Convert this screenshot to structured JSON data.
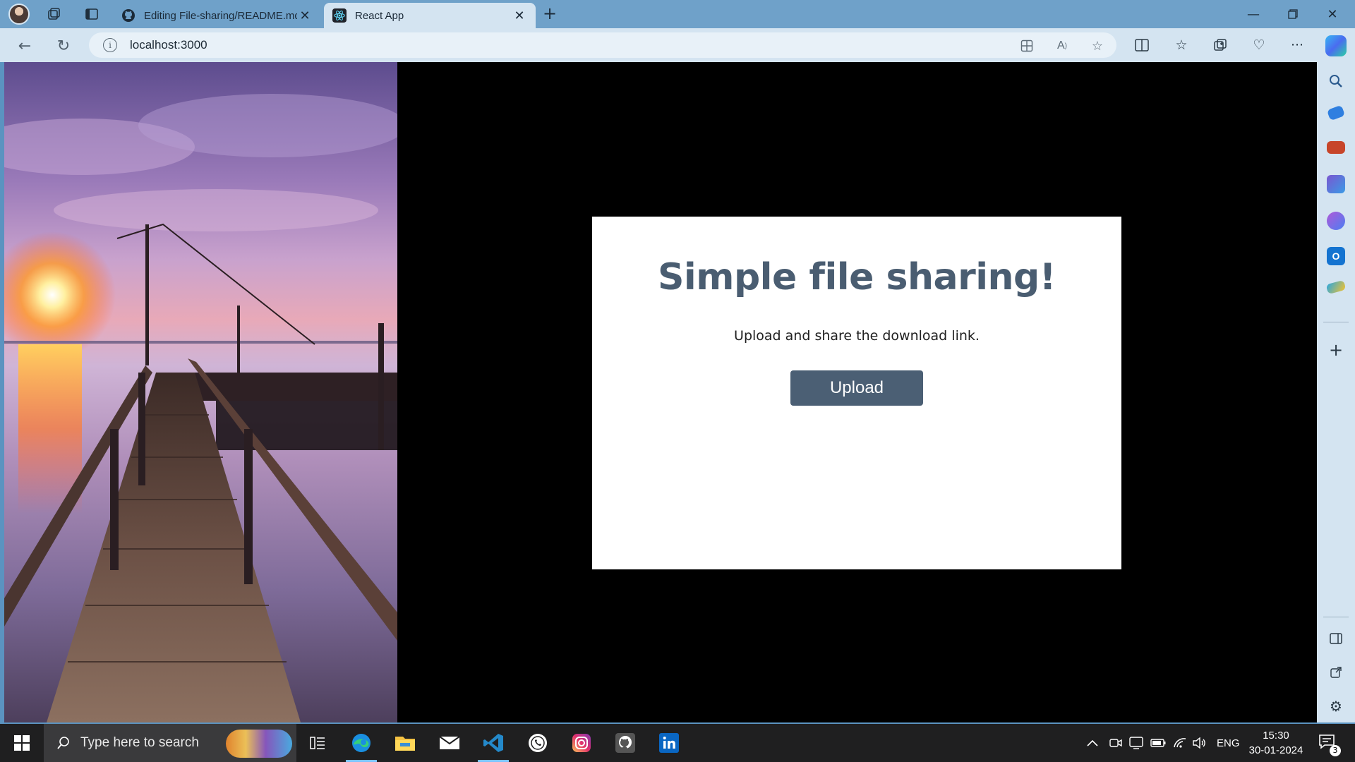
{
  "browser": {
    "tabs": [
      {
        "title": "Editing File-sharing/README.md",
        "icon": "github-icon"
      },
      {
        "title": "React App",
        "icon": "react-icon",
        "active": true
      }
    ],
    "address": {
      "url": "localhost:3000"
    }
  },
  "page": {
    "heading": "Simple file sharing!",
    "subtitle": "Upload and share the download link.",
    "upload_label": "Upload",
    "accent_color": "#4b5f74"
  },
  "taskbar": {
    "search_placeholder": "Type here to search",
    "apps": [
      "task-view-icon",
      "edge-icon",
      "file-explorer-icon",
      "mail-icon",
      "vscode-icon",
      "whatsapp-icon",
      "instagram-icon",
      "github-icon",
      "linkedin-icon"
    ],
    "tray": {
      "language": "ENG",
      "time": "15:30",
      "date": "30-01-2024",
      "notifications": "3"
    }
  }
}
